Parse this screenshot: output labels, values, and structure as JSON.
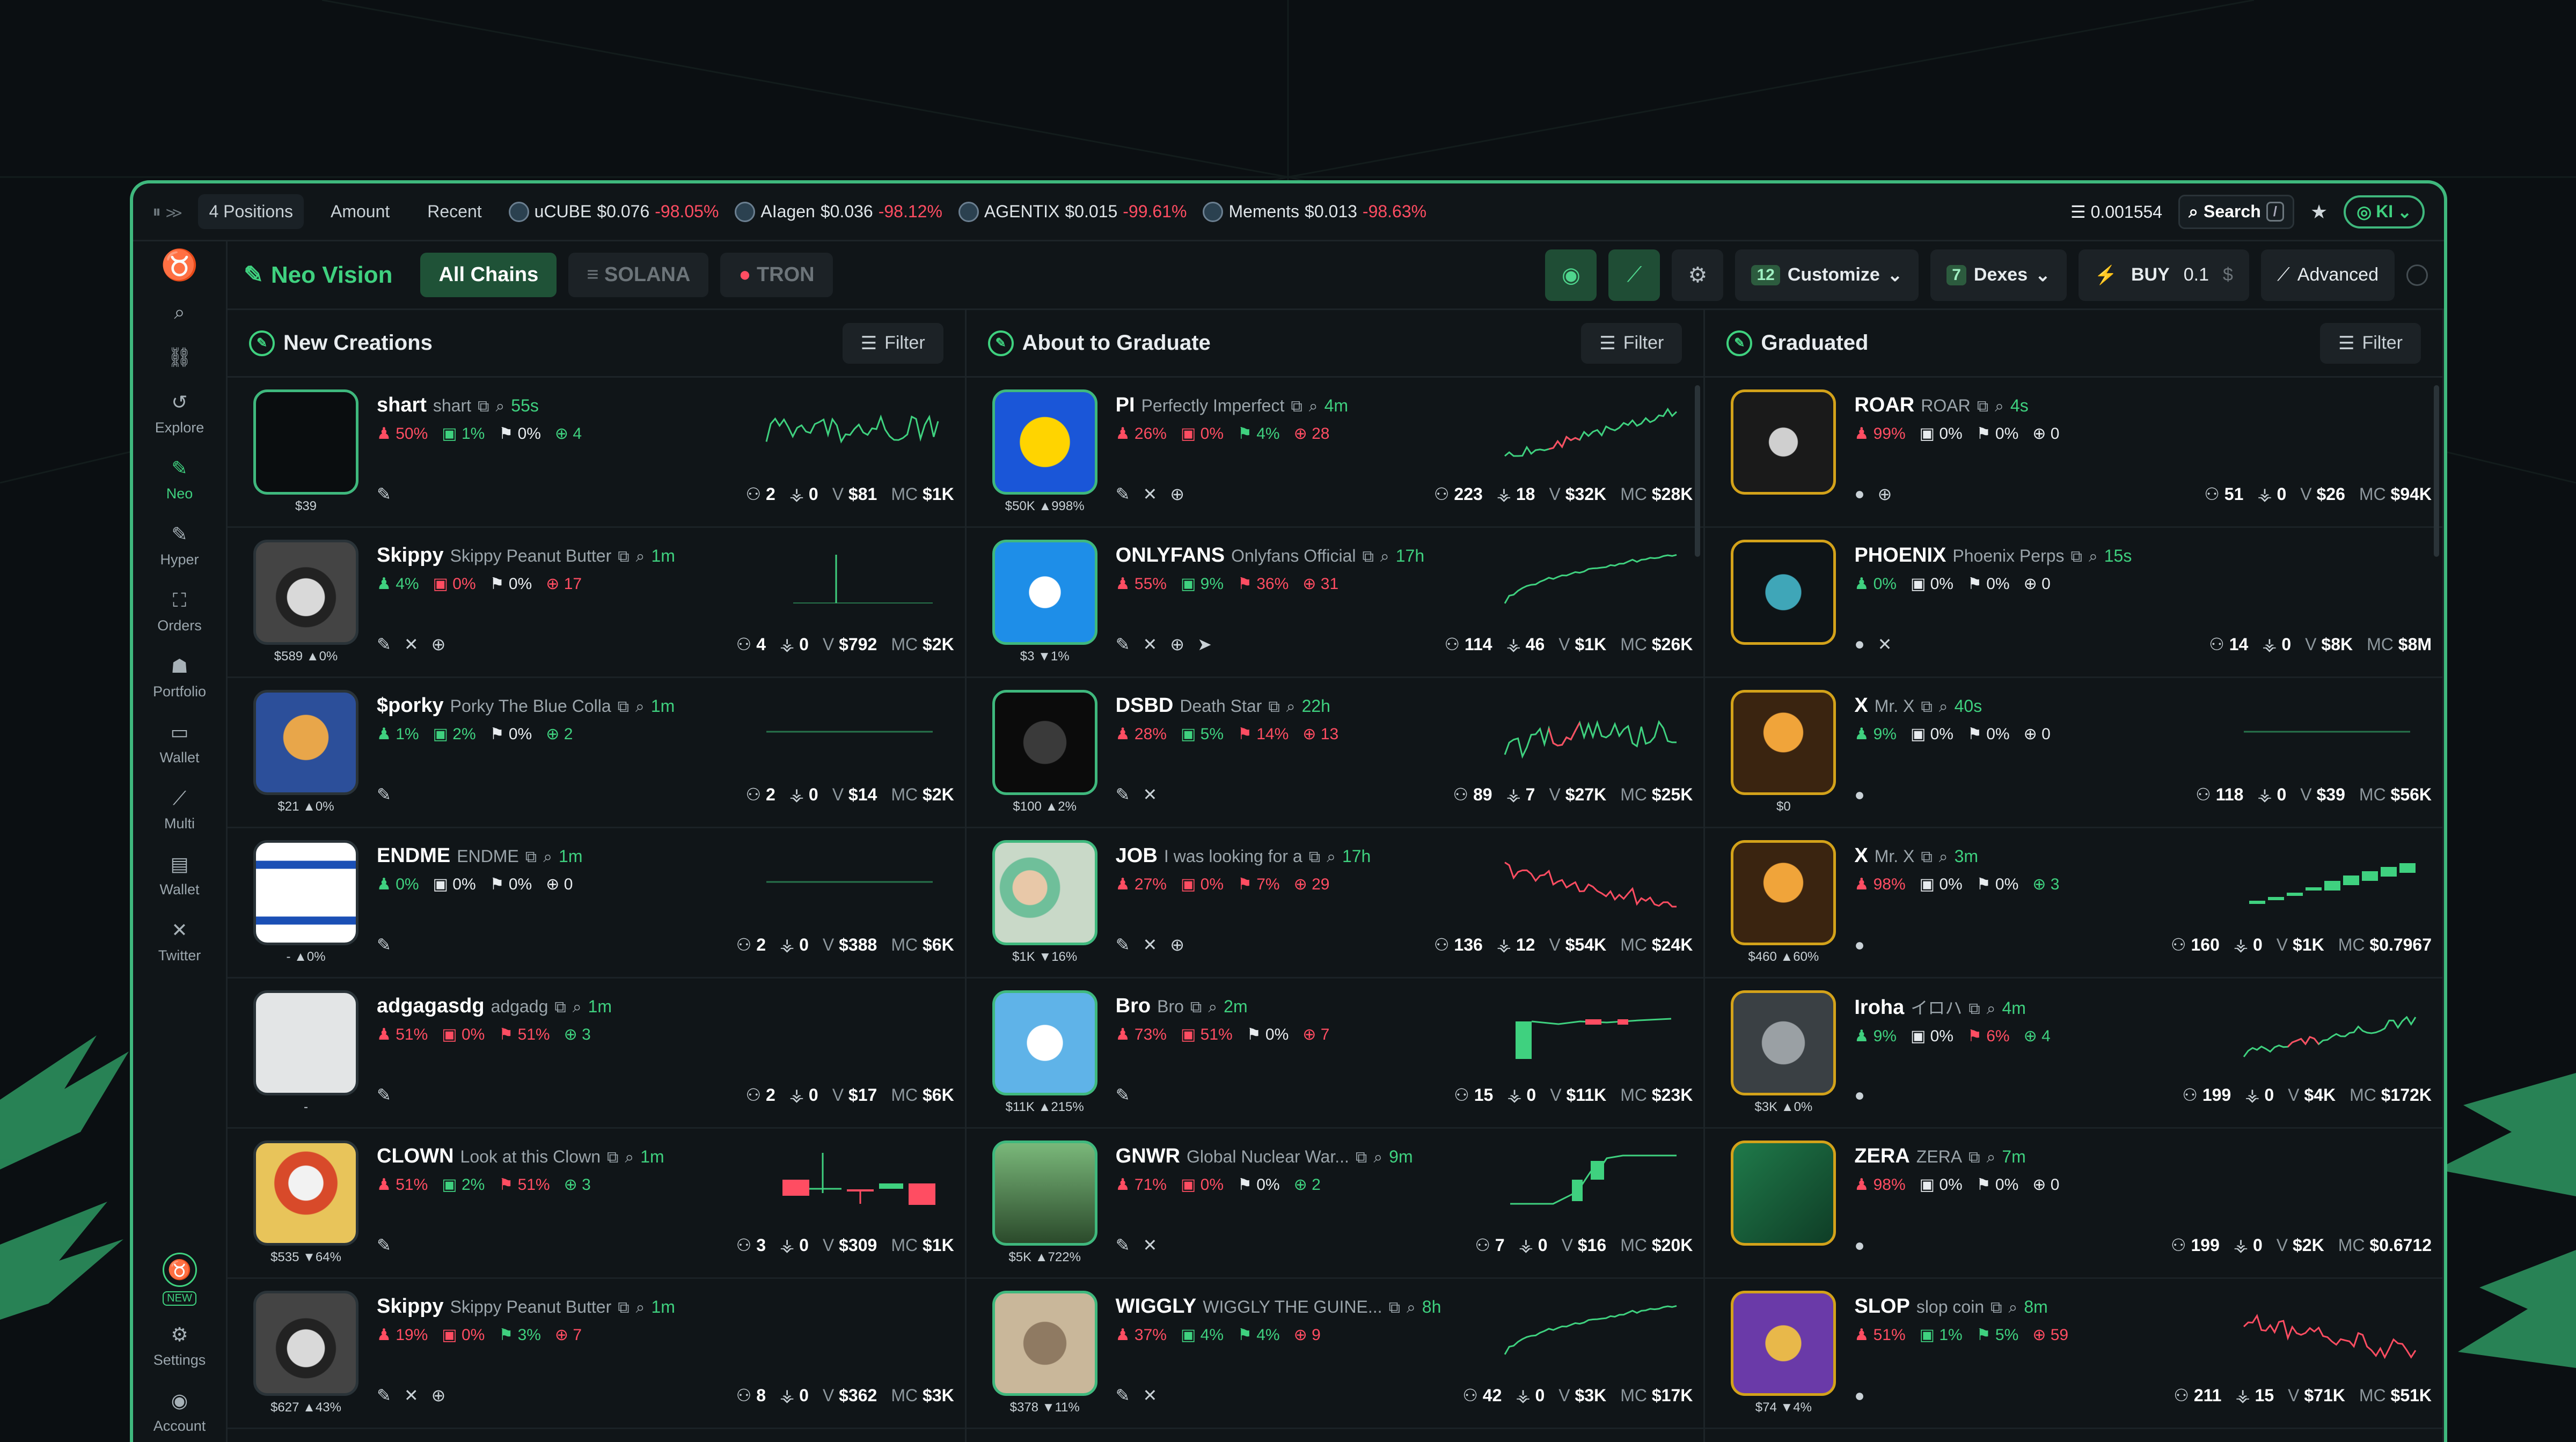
{
  "topbar": {
    "positions": "4 Positions",
    "amount": "Amount",
    "recent": "Recent",
    "tickers": [
      {
        "name": "uCUBE",
        "price": "$0.076",
        "change": "-98.05%"
      },
      {
        "name": "AIagen",
        "price": "$0.036",
        "change": "-98.12%"
      },
      {
        "name": "AGENTIX",
        "price": "$0.015",
        "change": "-99.61%"
      },
      {
        "name": "Mements",
        "price": "$0.013",
        "change": "-98.63%"
      }
    ],
    "balance": "0.001554",
    "search": "Search",
    "search_key": "/",
    "user": "KI"
  },
  "sidebar": {
    "items": [
      {
        "label": "",
        "icon": "search-icon"
      },
      {
        "label": "",
        "icon": "link-icon"
      },
      {
        "label": "Explore",
        "icon": "explore-icon"
      },
      {
        "label": "Neo",
        "icon": "neo-icon"
      },
      {
        "label": "Hyper",
        "icon": "hyper-icon"
      },
      {
        "label": "Orders",
        "icon": "orders-icon"
      },
      {
        "label": "Portfolio",
        "icon": "portfolio-icon"
      },
      {
        "label": "Wallet",
        "icon": "wallet-icon"
      },
      {
        "label": "Multi",
        "icon": "multi-icon"
      },
      {
        "label": "Wallet",
        "icon": "wallet-icon"
      },
      {
        "label": "Twitter",
        "icon": "twitter-icon"
      }
    ],
    "new_badge": "NEW",
    "settings": "Settings",
    "account": "Account"
  },
  "header": {
    "brand": "Neo Vision",
    "chains": [
      "All Chains",
      "SOLANA",
      "TRON"
    ],
    "customize_count": "12",
    "customize": "Customize",
    "dexes_count": "7",
    "dexes": "Dexes",
    "buy": "BUY",
    "buy_amount": "0.1",
    "currency": "$",
    "advanced": "Advanced"
  },
  "columns": [
    {
      "title": "New Creations",
      "filter": "Filter",
      "rows": [
        {
          "ticker": "shart",
          "name": "shart",
          "age": "55s",
          "label": "$39",
          "p1": "50%",
          "p2": "1%",
          "p3": "0%",
          "p4": "4",
          "holders": "2",
          "txs": "0",
          "vol": "$81",
          "mc": "$1K",
          "mcColor": "w",
          "border": "green",
          "spark": "noise",
          "c1": "neg",
          "c2": "pos",
          "c3": "neu",
          "c4": "pos"
        },
        {
          "ticker": "Skippy",
          "name": "Skippy Peanut Butter",
          "age": "1m",
          "label": "$589 ▲0%",
          "p1": "4%",
          "p2": "0%",
          "p3": "0%",
          "p4": "17",
          "holders": "4",
          "txs": "0",
          "vol": "$792",
          "mc": "$2K",
          "mcColor": "w",
          "border": "nb",
          "spark": "vline",
          "c1": "pos",
          "c2": "neg",
          "c3": "neu",
          "c4": "neg"
        },
        {
          "ticker": "$porky",
          "name": "Porky The Blue Colla",
          "age": "1m",
          "label": "$21 ▲0%",
          "p1": "1%",
          "p2": "2%",
          "p3": "0%",
          "p4": "2",
          "holders": "2",
          "txs": "0",
          "vol": "$14",
          "mc": "$2K",
          "mcColor": "w",
          "border": "nb",
          "spark": "flat",
          "c1": "pos",
          "c2": "pos",
          "c3": "neu",
          "c4": "pos"
        },
        {
          "ticker": "ENDME",
          "name": "ENDME",
          "age": "1m",
          "label": "- ▲0%",
          "p1": "0%",
          "p2": "0%",
          "p3": "0%",
          "p4": "0",
          "holders": "2",
          "txs": "0",
          "vol": "$388",
          "mc": "$6K",
          "mcColor": "w",
          "border": "nb",
          "spark": "flat",
          "c1": "pos",
          "c2": "neu",
          "c3": "neu",
          "c4": "neu"
        },
        {
          "ticker": "adgagasdg",
          "name": "adgadg",
          "age": "1m",
          "label": "-",
          "p1": "51%",
          "p2": "0%",
          "p3": "51%",
          "p4": "3",
          "holders": "2",
          "txs": "0",
          "vol": "$17",
          "mc": "$6K",
          "mcColor": "w",
          "border": "nb",
          "spark": "none",
          "c1": "neg",
          "c2": "neg",
          "c3": "neg",
          "c4": "pos"
        },
        {
          "ticker": "CLOWN",
          "name": "Look at this Clown",
          "age": "1m",
          "label": "$535 ▼64%",
          "p1": "51%",
          "p2": "2%",
          "p3": "51%",
          "p4": "3",
          "holders": "3",
          "txs": "0",
          "vol": "$309",
          "mc": "$1K",
          "mcColor": "w",
          "border": "nb",
          "spark": "candles",
          "c1": "neg",
          "c2": "pos",
          "c3": "neg",
          "c4": "pos"
        },
        {
          "ticker": "Skippy",
          "name": "Skippy Peanut Butter",
          "age": "1m",
          "label": "$627 ▲43%",
          "p1": "19%",
          "p2": "0%",
          "p3": "3%",
          "p4": "7",
          "holders": "8",
          "txs": "0",
          "vol": "$362",
          "mc": "$3K",
          "mcColor": "w",
          "border": "nb",
          "spark": "none",
          "c1": "neg",
          "c2": "neg",
          "c3": "pos",
          "c4": "neg"
        }
      ]
    },
    {
      "title": "About to Graduate",
      "filter": "Filter",
      "rows": [
        {
          "ticker": "PI",
          "name": "Perfectly Imperfect",
          "age": "4m",
          "label": "$50K ▲998%",
          "p1": "26%",
          "p2": "0%",
          "p3": "4%",
          "p4": "28",
          "holders": "223",
          "txs": "18",
          "vol": "$32K",
          "mc": "$28K",
          "mcColor": "b",
          "border": "green",
          "spark": "up",
          "c1": "neg",
          "c2": "neg",
          "c3": "pos",
          "c4": "neg"
        },
        {
          "ticker": "ONLYFANS",
          "name": "Onlyfans Official",
          "age": "17h",
          "label": "$3 ▼1%",
          "p1": "55%",
          "p2": "9%",
          "p3": "36%",
          "p4": "31",
          "holders": "114",
          "txs": "46",
          "vol": "$1K",
          "mc": "$26K",
          "mcColor": "b",
          "border": "green",
          "spark": "rise",
          "c1": "neg",
          "c2": "pos",
          "c3": "neg",
          "c4": "neg"
        },
        {
          "ticker": "DSBD",
          "name": "Death Star",
          "age": "22h",
          "label": "$100 ▲2%",
          "p1": "28%",
          "p2": "5%",
          "p3": "14%",
          "p4": "13",
          "holders": "89",
          "txs": "7",
          "vol": "$27K",
          "mc": "$25K",
          "mcColor": "b",
          "border": "green",
          "spark": "choppy",
          "c1": "neg",
          "c2": "pos",
          "c3": "neg",
          "c4": "neg"
        },
        {
          "ticker": "JOB",
          "name": "I was looking for a",
          "age": "17h",
          "label": "$1K ▼16%",
          "p1": "27%",
          "p2": "0%",
          "p3": "7%",
          "p4": "29",
          "holders": "136",
          "txs": "12",
          "vol": "$54K",
          "mc": "$24K",
          "mcColor": "b",
          "border": "green",
          "spark": "down",
          "c1": "neg",
          "c2": "neg",
          "c3": "neg",
          "c4": "neg"
        },
        {
          "ticker": "Bro",
          "name": "Bro",
          "age": "2m",
          "label": "$11K ▲215%",
          "p1": "73%",
          "p2": "51%",
          "p3": "0%",
          "p4": "7",
          "holders": "15",
          "txs": "0",
          "vol": "$11K",
          "mc": "$23K",
          "mcColor": "b",
          "border": "green",
          "spark": "jump",
          "c1": "neg",
          "c2": "neg",
          "c3": "neu",
          "c4": "neg"
        },
        {
          "ticker": "GNWR",
          "name": "Global Nuclear War...",
          "age": "9m",
          "label": "$5K ▲722%",
          "p1": "71%",
          "p2": "0%",
          "p3": "0%",
          "p4": "2",
          "holders": "7",
          "txs": "0",
          "vol": "$16",
          "mc": "$20K",
          "mcColor": "b",
          "border": "green",
          "spark": "step",
          "c1": "neg",
          "c2": "neg",
          "c3": "neu",
          "c4": "pos"
        },
        {
          "ticker": "WIGGLY",
          "name": "WIGGLY THE GUINE...",
          "age": "8h",
          "label": "$378 ▼11%",
          "p1": "37%",
          "p2": "4%",
          "p3": "4%",
          "p4": "9",
          "holders": "42",
          "txs": "0",
          "vol": "$3K",
          "mc": "$17K",
          "mcColor": "b",
          "border": "green",
          "spark": "rise",
          "c1": "neg",
          "c2": "pos",
          "c3": "pos",
          "c4": "neg"
        }
      ]
    },
    {
      "title": "Graduated",
      "filter": "Filter",
      "rows": [
        {
          "ticker": "ROAR",
          "name": "ROAR",
          "age": "4s",
          "label": "",
          "p1": "99%",
          "p2": "0%",
          "p3": "0%",
          "p4": "0",
          "holders": "51",
          "txs": "0",
          "vol": "$26",
          "mc": "$94K",
          "mcColor": "y",
          "border": "gold",
          "spark": "none",
          "c1": "neg",
          "c2": "neu",
          "c3": "neu",
          "c4": "neu"
        },
        {
          "ticker": "PHOENIX",
          "name": "Phoenix Perps",
          "age": "15s",
          "label": "",
          "p1": "0%",
          "p2": "0%",
          "p3": "0%",
          "p4": "0",
          "holders": "14",
          "txs": "0",
          "vol": "$8K",
          "mc": "$8M",
          "mcColor": "y",
          "border": "gold",
          "spark": "none",
          "c1": "pos",
          "c2": "neu",
          "c3": "neu",
          "c4": "neu"
        },
        {
          "ticker": "X",
          "name": "Mr. X",
          "age": "40s",
          "label": "$0",
          "p1": "9%",
          "p2": "0%",
          "p3": "0%",
          "p4": "0",
          "holders": "118",
          "txs": "0",
          "vol": "$39",
          "mc": "$56K",
          "mcColor": "y",
          "border": "gold",
          "spark": "flat",
          "c1": "pos",
          "c2": "neu",
          "c3": "neu",
          "c4": "neu"
        },
        {
          "ticker": "X",
          "name": "Mr. X",
          "age": "3m",
          "label": "$460 ▲60%",
          "p1": "98%",
          "p2": "0%",
          "p3": "0%",
          "p4": "3",
          "holders": "160",
          "txs": "0",
          "vol": "$1K",
          "mc": "$0.7967",
          "mcColor": "w",
          "border": "gold",
          "spark": "greens",
          "c1": "neg",
          "c2": "neu",
          "c3": "neu",
          "c4": "pos"
        },
        {
          "ticker": "Iroha",
          "name": "イロハ",
          "age": "4m",
          "label": "$3K ▲0%",
          "p1": "9%",
          "p2": "0%",
          "p3": "6%",
          "p4": "4",
          "holders": "199",
          "txs": "0",
          "vol": "$4K",
          "mc": "$172K",
          "mcColor": "y",
          "border": "gold",
          "spark": "mixed",
          "c1": "pos",
          "c2": "neu",
          "c3": "neg",
          "c4": "pos"
        },
        {
          "ticker": "ZERA",
          "name": "ZERA",
          "age": "7m",
          "label": "",
          "p1": "98%",
          "p2": "0%",
          "p3": "0%",
          "p4": "0",
          "holders": "199",
          "txs": "0",
          "vol": "$2K",
          "mc": "$0.6712",
          "mcColor": "w",
          "border": "gold",
          "spark": "none",
          "c1": "neg",
          "c2": "neu",
          "c3": "neu",
          "c4": "neu"
        },
        {
          "ticker": "SLOP",
          "name": "slop coin",
          "age": "8m",
          "label": "$74 ▼4%",
          "p1": "51%",
          "p2": "1%",
          "p3": "5%",
          "p4": "59",
          "holders": "211",
          "txs": "15",
          "vol": "$71K",
          "mc": "$51K",
          "mcColor": "y",
          "border": "gold",
          "spark": "reddown",
          "c1": "neg",
          "c2": "pos",
          "c3": "pos",
          "c4": "neg"
        }
      ]
    }
  ]
}
